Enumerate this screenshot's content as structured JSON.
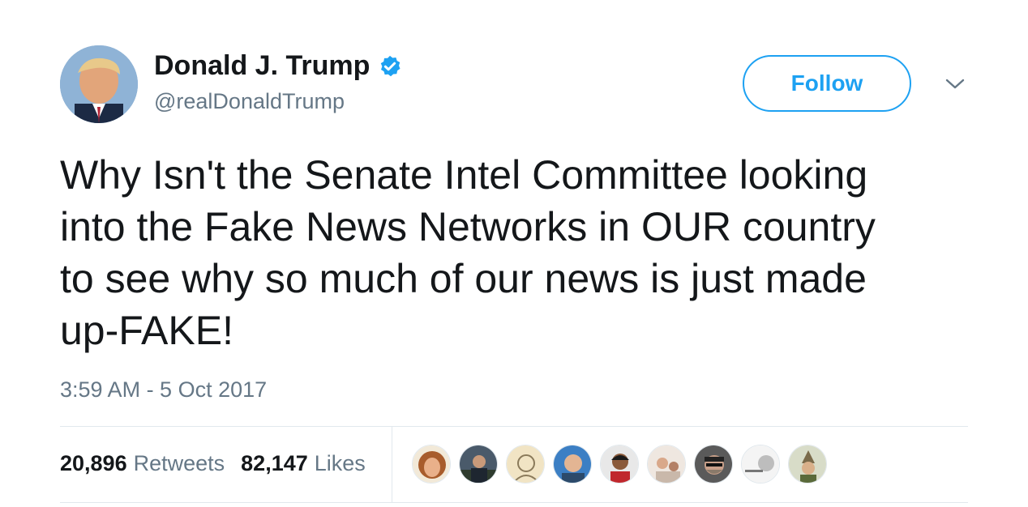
{
  "author": {
    "display_name": "Donald J. Trump",
    "handle": "@realDonaldTrump",
    "verified": true,
    "avatar_icon": "profile-photo-icon"
  },
  "actions": {
    "follow_label": "Follow",
    "menu_icon": "chevron-down-icon"
  },
  "tweet": {
    "text": "Why Isn't the Senate Intel Committee looking\ninto the Fake News Networks in OUR country\nto see why so much of our news is just made\nup-FAKE!",
    "timestamp": "3:59 AM - 5 Oct 2017"
  },
  "stats": {
    "retweets_count": "20,896",
    "retweets_label": "Retweets",
    "likes_count": "82,147",
    "likes_label": "Likes"
  },
  "likers": [
    {
      "icon": "liker-avatar-icon"
    },
    {
      "icon": "liker-avatar-icon"
    },
    {
      "icon": "liker-avatar-icon"
    },
    {
      "icon": "liker-avatar-icon"
    },
    {
      "icon": "liker-avatar-icon"
    },
    {
      "icon": "liker-avatar-icon"
    },
    {
      "icon": "liker-avatar-icon"
    },
    {
      "icon": "liker-avatar-icon"
    },
    {
      "icon": "liker-avatar-icon"
    }
  ],
  "colors": {
    "accent": "#1da1f2",
    "text_primary": "#14171a",
    "text_secondary": "#657786",
    "divider": "#e1e8ed"
  }
}
